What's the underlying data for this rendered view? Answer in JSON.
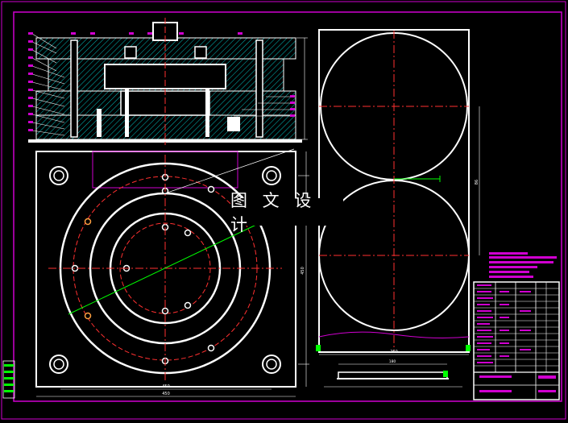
{
  "watermark": "图 文 设 计",
  "dimensions": {
    "plan_width": "450",
    "plan_width_inner": "450",
    "strip_width": "260",
    "plan_side": "450",
    "step": "86",
    "part_width": "180"
  },
  "colors": {
    "background": "#000000",
    "frame": "#d000d0",
    "line": "#ffffff",
    "center": "#ff3030",
    "accent": "#00c0c0",
    "dim": "#00ff00",
    "orange": "#ffa040",
    "yellow": "#ffff00"
  }
}
